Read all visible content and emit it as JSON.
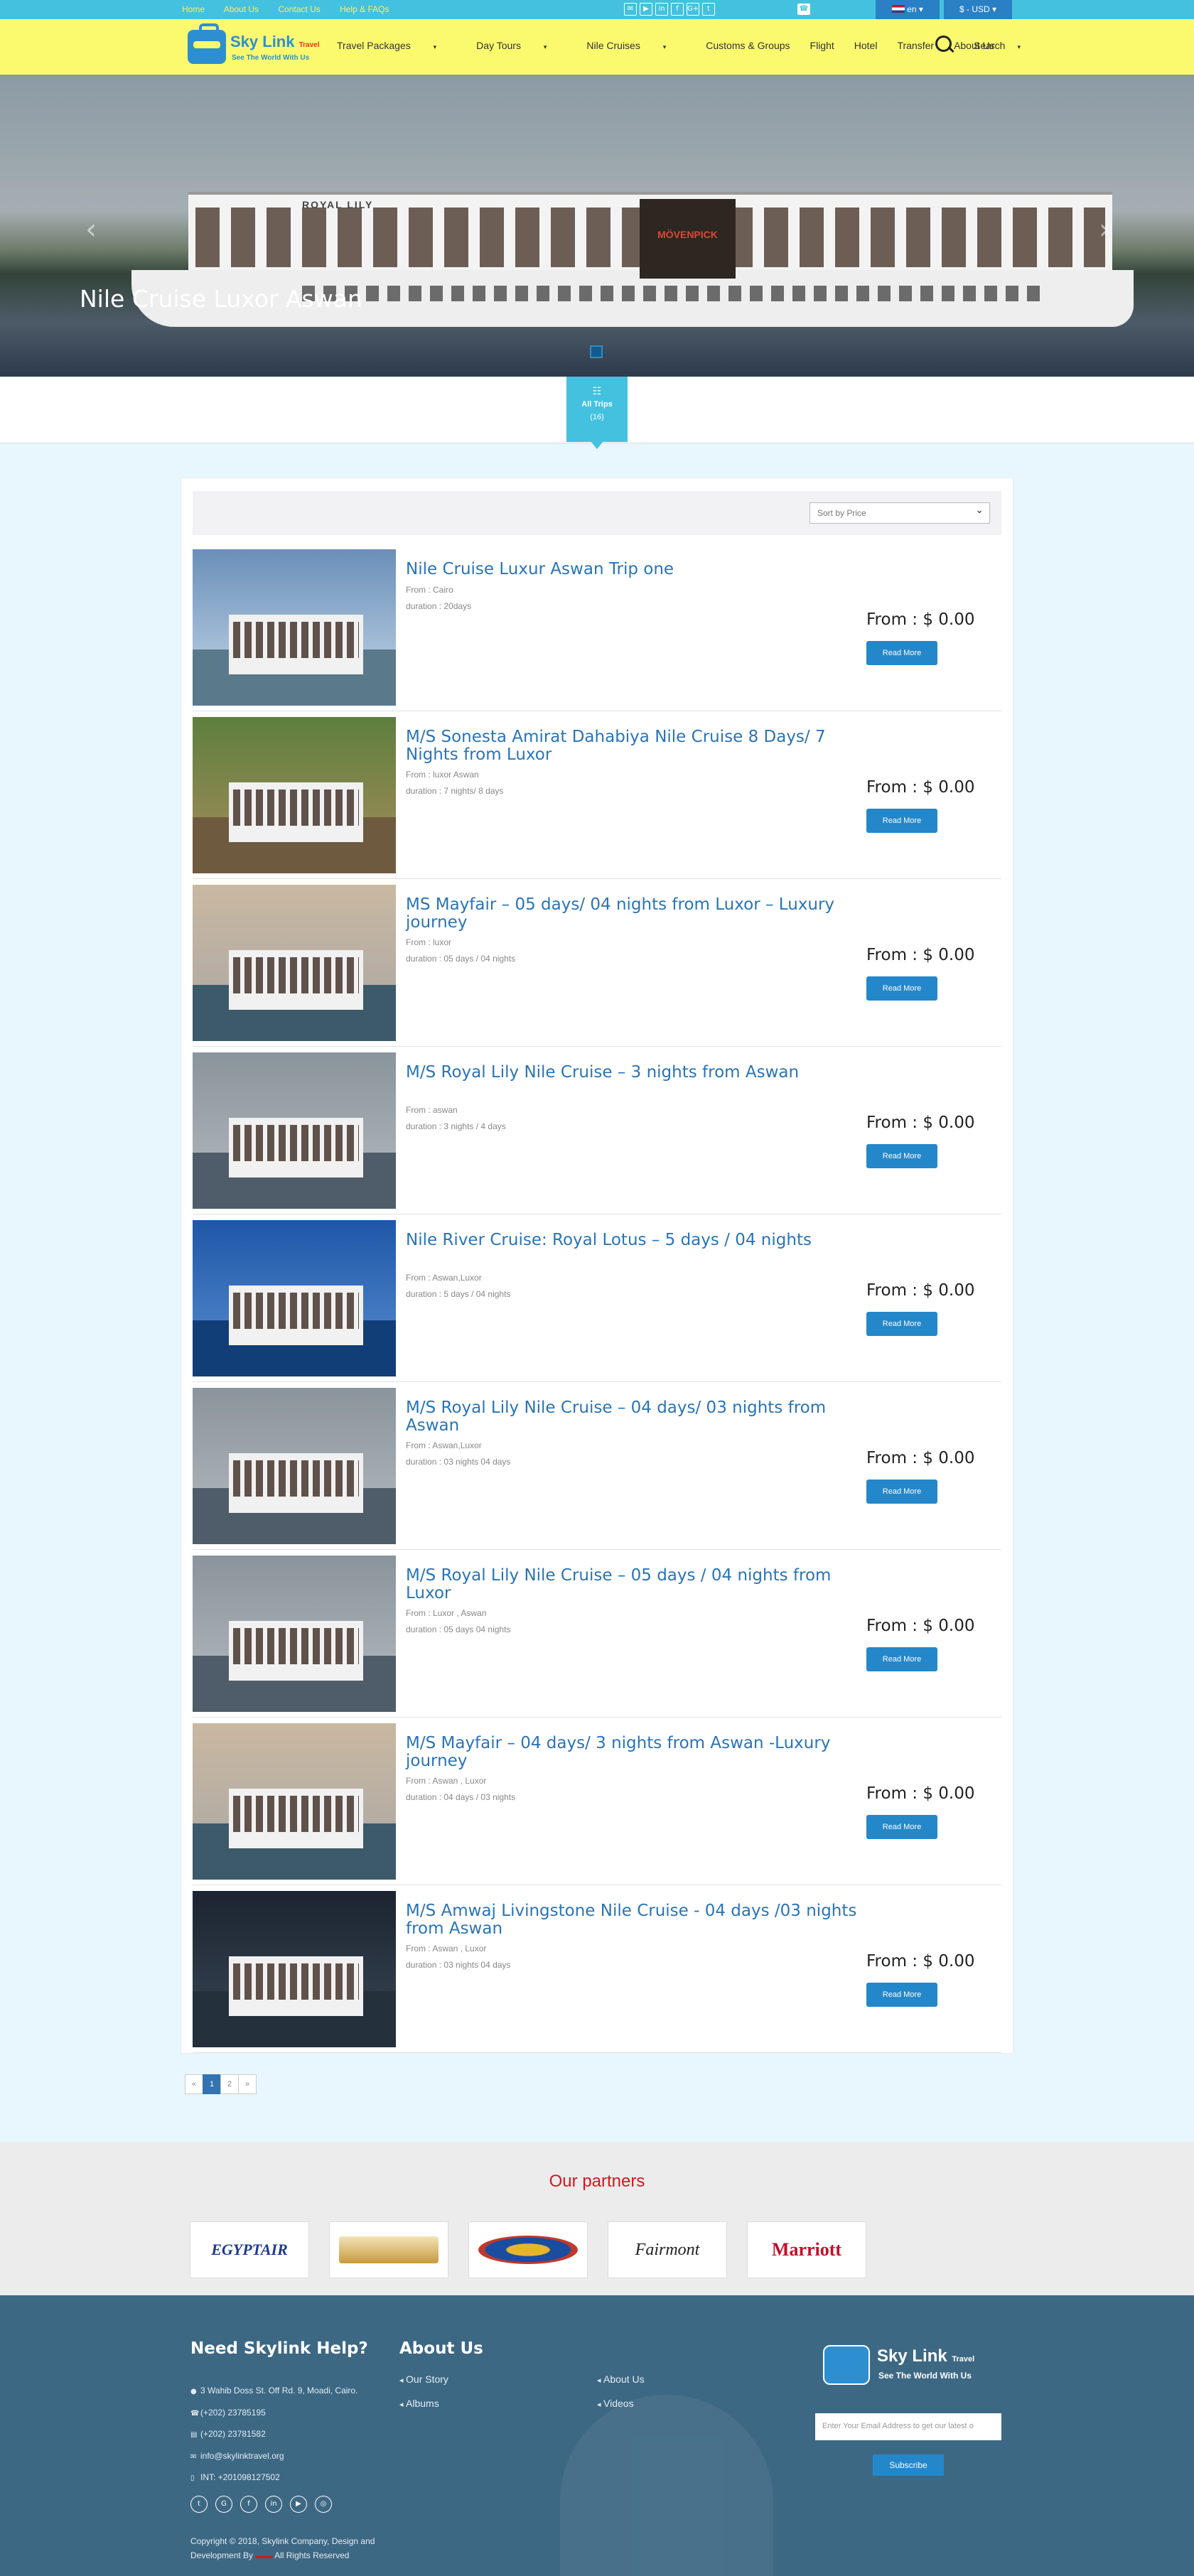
{
  "topbar": {
    "links": [
      "Home",
      "About Us",
      "Contact Us",
      "Help & FAQs"
    ],
    "social_icons": [
      "email-icon",
      "youtube-icon",
      "linkedin-icon",
      "facebook-icon",
      "google-plus-icon",
      "twitter-icon"
    ],
    "phone_icon": "phone-icon",
    "language": "en",
    "currency": "$ - USD"
  },
  "header": {
    "logo_name": "Sky Link",
    "logo_sub": "Travel",
    "logo_tagline": "See The World With Us",
    "nav": [
      "Travel Packages",
      "Day Tours",
      "Nile Cruises",
      "Customs & Groups",
      "Flight",
      "Hotel",
      "Transfer",
      "About Us"
    ],
    "search_label": "Search"
  },
  "hero": {
    "caption": "Nile Cruise Luxor Aswan",
    "ship_name": "ROYAL LILY",
    "ship_brand": "MÖVENPICK"
  },
  "tab": {
    "label": "All Trips",
    "count": "(16)"
  },
  "sort": {
    "selected": "Sort by Price"
  },
  "trips": [
    {
      "title": "Nile Cruise Luxur Aswan Trip one",
      "from": "From : Cairo",
      "duration": "duration : 20days",
      "price": "From : $ 0.00",
      "button": "Read More"
    },
    {
      "title": "M/S Sonesta Amirat Dahabiya Nile Cruise 8 Days/ 7 Nights from Luxor",
      "from": "From : luxor Aswan",
      "duration": "duration : 7 nights/ 8 days",
      "price": "From : $ 0.00",
      "button": "Read More"
    },
    {
      "title": "MS Mayfair – 05 days/ 04 nights from Luxor – Luxury journey",
      "from": "From : luxor",
      "duration": "duration : 05 days / 04 nights",
      "price": "From : $ 0.00",
      "button": "Read More"
    },
    {
      "title": "M/S Royal Lily Nile Cruise – 3 nights from Aswan",
      "from": "From : aswan",
      "duration": "duration : 3 nights / 4 days",
      "price": "From : $ 0.00",
      "button": "Read More"
    },
    {
      "title": "Nile River Cruise: Royal Lotus – 5 days / 04 nights",
      "from": "From : Aswan,Luxor",
      "duration": "duration : 5 days / 04 nights",
      "price": "From : $ 0.00",
      "button": "Read More"
    },
    {
      "title": "M/S Royal Lily Nile Cruise – 04 days/ 03 nights from Aswan",
      "from": "From : Aswan,Luxor",
      "duration": "duration : 03 nights 04 days",
      "price": "From : $ 0.00",
      "button": "Read More"
    },
    {
      "title": "M/S Royal Lily Nile Cruise – 05 days / 04 nights from Luxor",
      "from": "From : Luxor , Aswan",
      "duration": "duration : 05 days 04 nights",
      "price": "From : $ 0.00",
      "button": "Read More"
    },
    {
      "title": "M/S Mayfair – 04 days/ 3 nights from Aswan -Luxury journey",
      "from": "From : Aswan , Luxor",
      "duration": "duration : 04 days / 03 nights",
      "price": "From : $ 0.00",
      "button": "Read More"
    },
    {
      "title": "M/S Amwaj Livingstone Nile Cruise - 04 days /03 nights from Aswan",
      "from": "From : Aswan , Luxor",
      "duration": "duration : 03 nights 04 days",
      "price": "From : $ 0.00",
      "button": "Read More"
    }
  ],
  "pager": {
    "prev": "«",
    "pages": [
      "1",
      "2"
    ],
    "next": "»"
  },
  "partners": {
    "title": "Our partners",
    "logos": [
      "EGYPTAIR",
      "",
      "",
      "Fairmont",
      "Marriott"
    ]
  },
  "footer": {
    "help_title": "Need Skylink Help?",
    "address": "3 Wahib Doss St. Off Rd. 9, Moadi, Cairo.",
    "phone": "(+202) 23785195",
    "fax": "(+202) 23781582",
    "email": "info@skylinktravel.org",
    "mobile": "INT: +201098127502",
    "about_title": "About Us",
    "links_col1": [
      "Our Story",
      "Albums"
    ],
    "links_col2": [
      "About Us",
      "Videos"
    ],
    "social_icons": [
      "twitter-icon",
      "google-plus-icon",
      "facebook-icon",
      "linkedin-icon",
      "youtube-icon",
      "instagram-icon"
    ],
    "copyright_1": "Copyright © 2018, Skylink Company, Design and",
    "copyright_2a": "Development By",
    "copyright_2b": "All Rights Reserved",
    "email_placeholder": "Enter Your Email Address to get our latest o",
    "subscribe_label": "Subscribe"
  },
  "colors": {
    "topbar": "#45c1e0",
    "header": "#fbfa6e",
    "accent": "#2487ca",
    "title_link": "#2a74b6",
    "partners_title": "#d6161f",
    "footer": "#3d6884",
    "page_bg": "#e8f6fd"
  }
}
